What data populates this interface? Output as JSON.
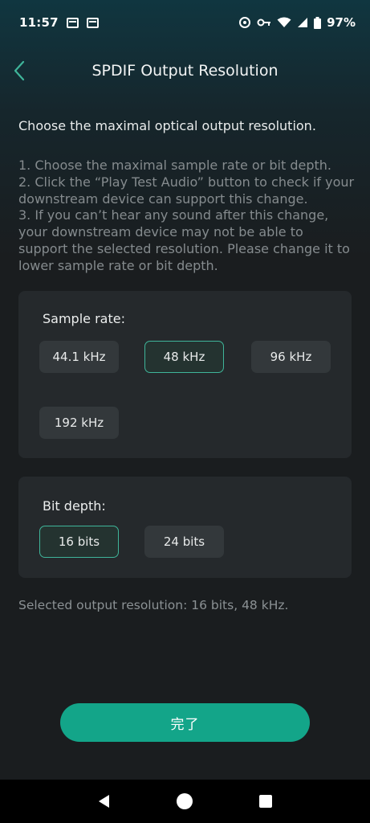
{
  "status_bar": {
    "time": "11:57",
    "battery": "97%",
    "left_icons": [
      "notification-icon",
      "notification-icon"
    ],
    "right_icons": [
      "target-icon",
      "key-icon",
      "wifi-icon",
      "signal-icon",
      "battery-icon"
    ]
  },
  "header": {
    "title": "SPDIF Output Resolution",
    "back_icon": "chevron-left-icon"
  },
  "intro": "Choose the maximal optical output resolution.",
  "instructions": [
    "1. Choose the maximal sample rate or bit depth.",
    "2. Click the “Play Test Audio” button to check if your downstream device can support this change.",
    "3. If you can’t hear any sound after this change, your downstream device may not be able to support the selected resolution. Please change it to lower sample rate or bit depth."
  ],
  "sample_rate": {
    "label": "Sample rate:",
    "options": [
      "44.1 kHz",
      "48 kHz",
      "96 kHz",
      "192 kHz"
    ],
    "selected": "48 kHz"
  },
  "bit_depth": {
    "label": "Bit depth:",
    "options": [
      "16 bits",
      "24 bits"
    ],
    "selected": "16 bits"
  },
  "summary": "Selected output resolution: 16 bits, 48 kHz.",
  "done_button": "完了",
  "nav_bar": {
    "icons": [
      "back-triangle-icon",
      "home-circle-icon",
      "recents-square-icon"
    ]
  },
  "colors": {
    "accent": "#13a589",
    "selected_border": "#3fb59a",
    "card_bg": "#25292c",
    "page_bg": "#1a1d1f"
  }
}
